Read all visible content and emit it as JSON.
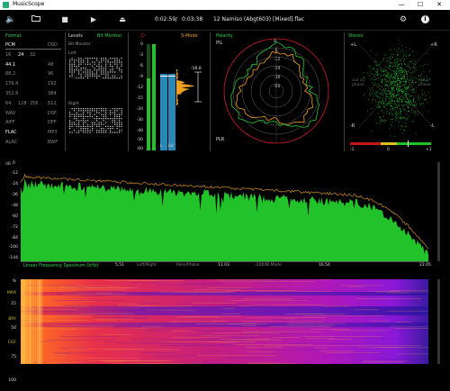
{
  "window": {
    "title": "MusicScope",
    "min_glyph": "—",
    "max_glyph": "☐",
    "close_glyph": "✕"
  },
  "toolbar": {
    "volume_glyph": "🔈",
    "folder_glyph": "▭",
    "stop_glyph": "■",
    "play_glyph": "▶",
    "eject_glyph": "⏏",
    "time_current": "0:02:59",
    "time_sep": "/",
    "time_total": "0:03:38",
    "file_name": "12 Namiso (Abgt603) [Mixed].flac",
    "settings_glyph": "⚙",
    "info_glyph": "i"
  },
  "format": {
    "title": "Format",
    "rows": [
      [
        "PCM",
        "",
        "",
        "DSD"
      ],
      [
        "16",
        "24",
        "32",
        ""
      ],
      [
        "44.1",
        "",
        "",
        "48"
      ],
      [
        "88.2",
        "",
        "",
        "96"
      ],
      [
        "176.4",
        "",
        "",
        "192"
      ],
      [
        "352.8",
        "",
        "",
        "384"
      ],
      [
        "64",
        "128",
        "256",
        "512"
      ],
      [
        "WAV",
        "",
        "",
        "DSF"
      ],
      [
        "AIFF",
        "",
        "",
        "DFF"
      ],
      [
        "FLAC",
        "",
        "",
        "MP3"
      ],
      [
        "ALAC",
        "",
        "",
        "BWF"
      ]
    ],
    "active": [
      "PCM",
      "24",
      "44.1",
      "FLAC"
    ]
  },
  "levels": {
    "title": "Levels",
    "mode": "Bit Monitor",
    "sub": "Bit Monitor",
    "left": "Left",
    "right": "Right"
  },
  "meter": {
    "label_d": "D",
    "label_smode": "S-Mode",
    "scale": [
      "0",
      "-3",
      "-6",
      "-9",
      "-12",
      "-15",
      "-20",
      "-30",
      "-40",
      "-50",
      "-60"
    ],
    "peak_value": "-10.0",
    "channels": [
      "L",
      "LU"
    ]
  },
  "polar": {
    "title": "Polarity",
    "label_top": "PIL",
    "label_bottom": "PLR",
    "rings": [
      "0",
      "-6",
      "-12",
      "-24",
      "-36",
      "-60"
    ]
  },
  "stereo": {
    "title": "Stereo",
    "pl": "+L",
    "pr": "+R",
    "ml": "-R",
    "mr": "-L",
    "out_phase_left": "out of phase",
    "out_phase_right": "out of phase",
    "corr_left": "-1",
    "corr_mid": "0",
    "corr_right": "+1"
  },
  "spectrum": {
    "db_label": "dB",
    "y_ticks": [
      "0",
      "-12",
      "-24",
      "-36",
      "-48",
      "-60",
      "-72",
      "-84",
      "-100",
      "-144"
    ],
    "x_ticks": [
      "5.51",
      "11.03",
      "16.54",
      "22.05"
    ],
    "title": "Linear Frequency Spectrum (kHz)",
    "modes": [
      "Left/Right",
      "Pans/Phase",
      "-200dB Mode"
    ]
  },
  "sonogram": {
    "y_ticks": [
      "%",
      "MAX",
      "25",
      "BRY",
      "50",
      "CGF",
      "75",
      "100"
    ]
  },
  "colors": {
    "green": "#22c32a",
    "accent_green": "#2bd24a",
    "orange": "#f0a020",
    "red": "#e02020",
    "blue": "#2a88b8"
  }
}
